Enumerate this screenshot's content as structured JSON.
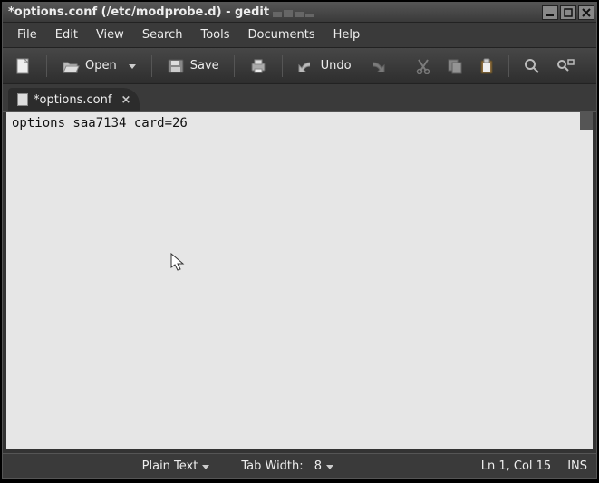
{
  "window": {
    "title": "*options.conf (/etc/modprobe.d) - gedit"
  },
  "menu": {
    "file": "File",
    "edit": "Edit",
    "view": "View",
    "search": "Search",
    "tools": "Tools",
    "documents": "Documents",
    "help": "Help"
  },
  "toolbar": {
    "open_label": "Open",
    "save_label": "Save",
    "undo_label": "Undo"
  },
  "tab": {
    "label": "*options.conf"
  },
  "editor": {
    "content": "options saa7134 card=26"
  },
  "status": {
    "syntax": "Plain Text",
    "tabwidth_label": "Tab Width:",
    "tabwidth_value": "8",
    "cursor": "Ln 1, Col 15",
    "insert": "INS"
  }
}
